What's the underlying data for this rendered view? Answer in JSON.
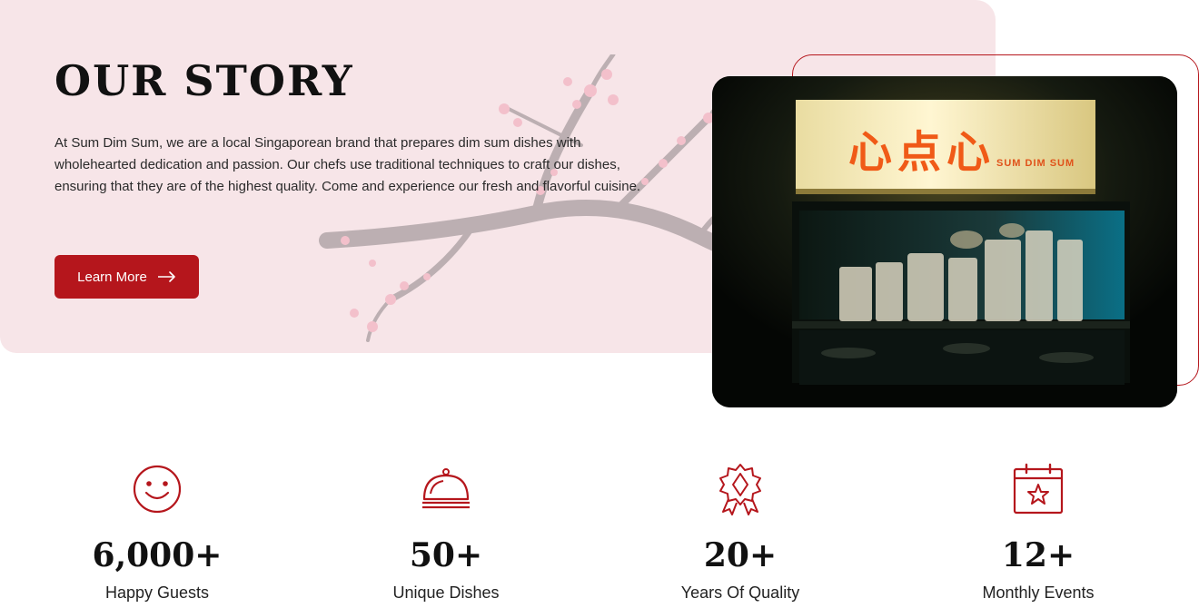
{
  "story": {
    "title": "OUR STORY",
    "description": "At Sum Dim Sum, we are a local Singaporean brand that prepares dim sum dishes with wholehearted dedication and passion. Our chefs use traditional techniques to craft our dishes, ensuring that they are of the highest quality. Come and experience our fresh and flavorful cuisine.",
    "button_label": "Learn More",
    "button_icon": "arrow-right-icon"
  },
  "photo": {
    "sign_chinese": "心点心",
    "sign_english": "SUM DIM SUM"
  },
  "stats": [
    {
      "icon": "smiley-icon",
      "value": "6,000+",
      "label": "Happy Guests"
    },
    {
      "icon": "cloche-icon",
      "value": "50+",
      "label": "Unique Dishes"
    },
    {
      "icon": "award-badge-icon",
      "value": "20+",
      "label": "Years Of Quality"
    },
    {
      "icon": "calendar-star-icon",
      "value": "12+",
      "label": "Monthly Events"
    }
  ],
  "colors": {
    "accent": "#b5161c",
    "hero_background": "#f7e5e8",
    "sign_text": "#f05a17"
  }
}
